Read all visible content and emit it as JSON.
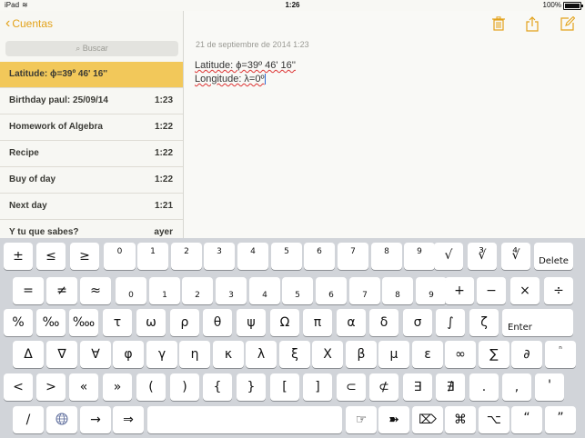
{
  "status_bar": {
    "carrier": "iPad",
    "time": "1:26",
    "battery": "100%"
  },
  "sidebar": {
    "back_label": "Cuentas",
    "search_placeholder": "Buscar",
    "notes": [
      {
        "title": "Latitude: ϕ=39º 46' 16''",
        "time": ""
      },
      {
        "title": "Birthday paul: 25/09/14",
        "time": "1:23"
      },
      {
        "title": "Homework of Algebra",
        "time": "1:22"
      },
      {
        "title": "Recipe",
        "time": "1:22"
      },
      {
        "title": "Buy of day",
        "time": "1:22"
      },
      {
        "title": "Next day",
        "time": "1:21"
      },
      {
        "title": "Y tu que sabes?",
        "time": "ayer"
      }
    ]
  },
  "detail": {
    "date": "21 de septiembre de 2014 1:23",
    "line1": "Latitude: ϕ=39º 46' 16''",
    "line2": "Longitude: λ=0º"
  },
  "toolbar_icons": [
    "trash-icon",
    "share-icon",
    "compose-icon"
  ],
  "accent_color": "#e3a21a",
  "keyboard": {
    "row1": [
      "±",
      "≤",
      "≥",
      "0",
      "1",
      "2",
      "3",
      "4",
      "5",
      "6",
      "7",
      "8",
      "9",
      "√",
      "∛",
      "∜",
      "Delete"
    ],
    "row2": [
      "=",
      "≠",
      "≈",
      "0",
      "1",
      "2",
      "3",
      "4",
      "5",
      "6",
      "7",
      "8",
      "9",
      "+",
      "−",
      "×",
      "÷"
    ],
    "row3": [
      "%",
      "‰",
      "‱",
      "τ",
      "ω",
      "ρ",
      "θ",
      "ψ",
      "Ω",
      "π",
      "α",
      "δ",
      "σ",
      "∫",
      "ζ",
      "Enter"
    ],
    "row4": [
      "Δ",
      "∇",
      "∀",
      "φ",
      "γ",
      "η",
      "κ",
      "λ",
      "ξ",
      "X",
      "β",
      "μ",
      "ε",
      "∞",
      "∑",
      "∂",
      "ⁿ"
    ],
    "row5": [
      "<",
      ">",
      "«",
      "»",
      "(",
      ")",
      "{",
      "}",
      "[",
      "]",
      "⊂",
      "⊄",
      "∃",
      "∄",
      ".",
      ",",
      "'"
    ],
    "row6": [
      "/",
      "globe",
      "→",
      "⇒",
      "space",
      "☞",
      "➽",
      "⌦",
      "⌘",
      "⌥",
      "“",
      "”"
    ]
  }
}
